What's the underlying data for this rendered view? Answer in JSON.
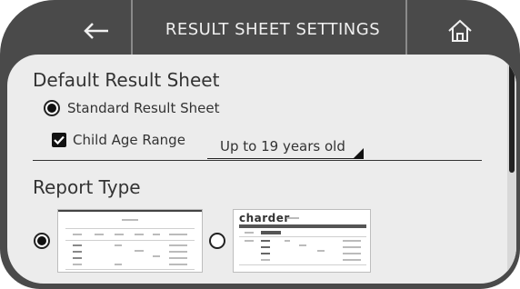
{
  "header": {
    "title": "RESULT SHEET SETTINGS",
    "back_icon": "back-arrow-icon",
    "home_icon": "home-icon"
  },
  "default_result_sheet": {
    "heading": "Default Result Sheet",
    "standard_option_label": "Standard Result Sheet",
    "standard_selected": true,
    "child_age_range_label": "Child Age Range",
    "child_age_range_checked": true,
    "child_age_range_value": "Up to 19 years old"
  },
  "report_type": {
    "heading": "Report Type",
    "options": [
      {
        "name": "standard-report",
        "selected": true
      },
      {
        "name": "charder-report",
        "selected": false,
        "brand_text": "charder"
      }
    ]
  },
  "colors": {
    "frame": "#4a4a4a",
    "screen": "#ececec",
    "text": "#333333",
    "accent": "#111111"
  }
}
